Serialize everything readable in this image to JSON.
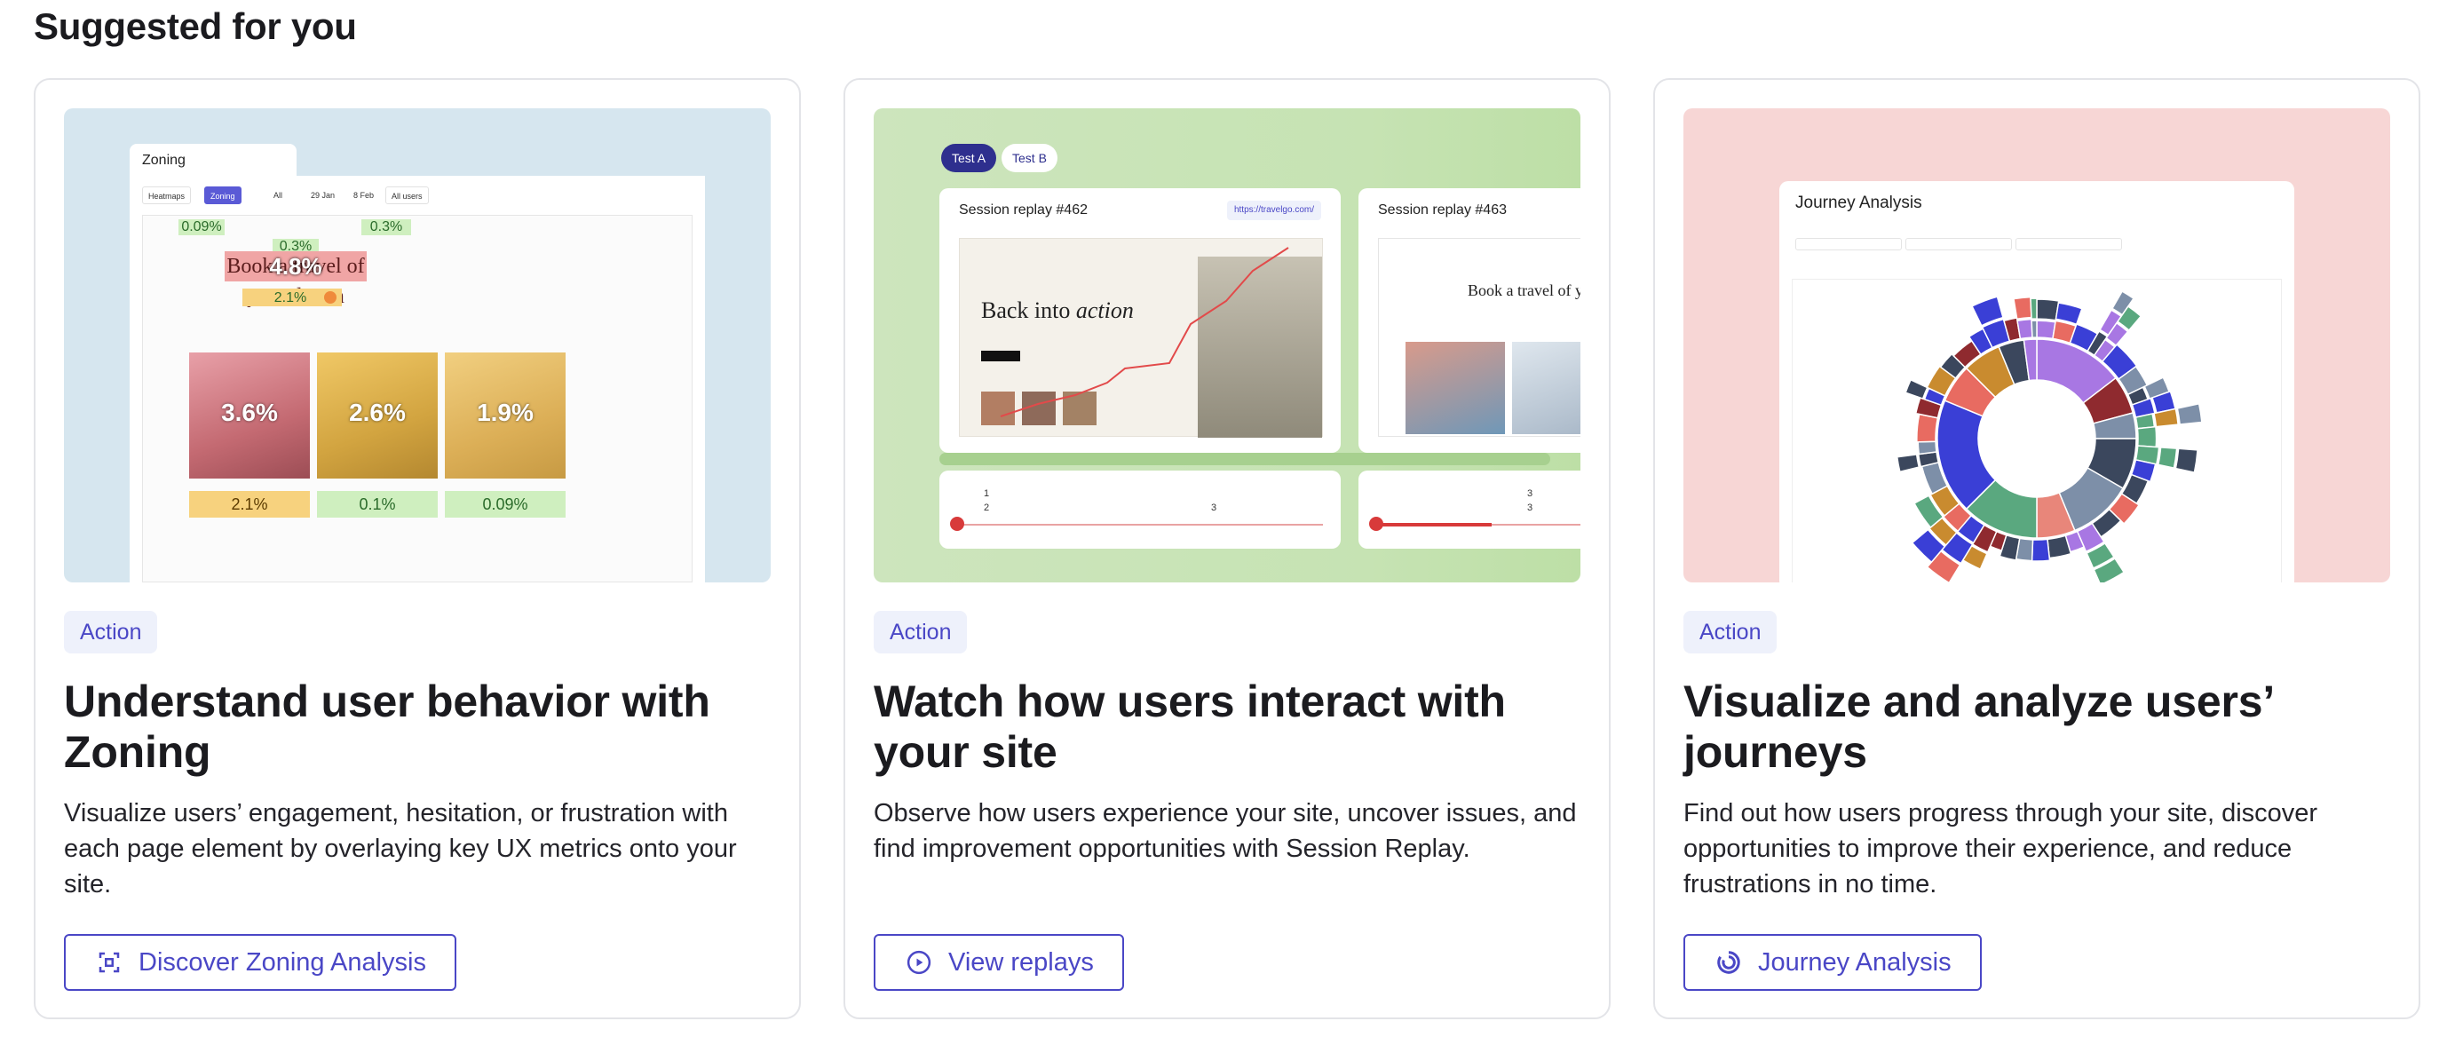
{
  "section": {
    "title": "Suggested for you"
  },
  "cards": [
    {
      "tag": "Action",
      "title": "Understand user behavior with Zoning",
      "description": "Visualize users’ engagement, hesitation, or frustration with each page element by overlaying key UX metrics onto your site.",
      "cta": "Discover Zoning Analysis",
      "cta_icon": "zoning-icon",
      "preview": {
        "window_title": "Zoning",
        "toolbar": [
          "Heatmaps",
          "Zoning",
          "All",
          "29 Jan",
          "8 Feb",
          "All users"
        ],
        "headline": "Book a travel of your dream",
        "metrics": [
          "0.09%",
          "0.3%",
          "0.3%",
          "4.8%",
          "2.1%",
          "3.6%",
          "2.6%",
          "1.9%",
          "2.1%",
          "0.1%",
          "0.09%"
        ]
      }
    },
    {
      "tag": "Action",
      "title": "Watch how users interact with your site",
      "description": "Observe how users experience your site, uncover issues, and find improvement opportunities with Session Replay.",
      "cta": "View replays",
      "cta_icon": "play-circle-icon",
      "preview": {
        "tabs": [
          "Test A",
          "Test B"
        ],
        "replay_1": "Session replay #462",
        "replay_2": "Session replay #463",
        "url": "https://travelgo.com/",
        "hero_1": "Back into",
        "hero_1_em": "action",
        "hero_2": "Book a travel of y",
        "events_1": [
          "1",
          "2",
          "3"
        ],
        "events_2": [
          "3",
          "3"
        ]
      }
    },
    {
      "tag": "Action",
      "title": "Visualize and analyze users’ journeys",
      "description": "Find out how users progress through your site, discover opportunities to improve their experience, and reduce frustrations in no time.",
      "cta": "Journey Analysis",
      "cta_icon": "journey-icon",
      "preview": {
        "window_title": "Journey Analysis"
      }
    }
  ],
  "colors": {
    "accent": "#4a47c6",
    "tag_bg": "#eef1fb",
    "thumb_zoning": "#d6e6ef",
    "thumb_replay": "#c6e3b3",
    "thumb_journey": "#f7d6d5"
  },
  "sunburst": {
    "inner": [
      {
        "v": 14,
        "c": "#a877e3"
      },
      {
        "v": 6,
        "c": "#8f2a2f"
      },
      {
        "v": 4,
        "c": "#7d8fa8"
      },
      {
        "v": 8,
        "c": "#3b475d"
      },
      {
        "v": 10,
        "c": "#7d8fa8"
      },
      {
        "v": 6,
        "c": "#e8867a"
      },
      {
        "v": 12,
        "c": "#5aa87f"
      },
      {
        "v": 18,
        "c": "#3a3fd6"
      },
      {
        "v": 6,
        "c": "#e86b61"
      },
      {
        "v": 6,
        "c": "#c98b2f"
      },
      {
        "v": 4,
        "c": "#3b475d"
      },
      {
        "v": 2,
        "c": "#a877e3"
      }
    ],
    "outer_colors": [
      "#3b475d",
      "#a877e3",
      "#5aa87f",
      "#3a3fd6",
      "#8f2a2f",
      "#7d8fa8",
      "#e86b61",
      "#c98b2f"
    ]
  }
}
